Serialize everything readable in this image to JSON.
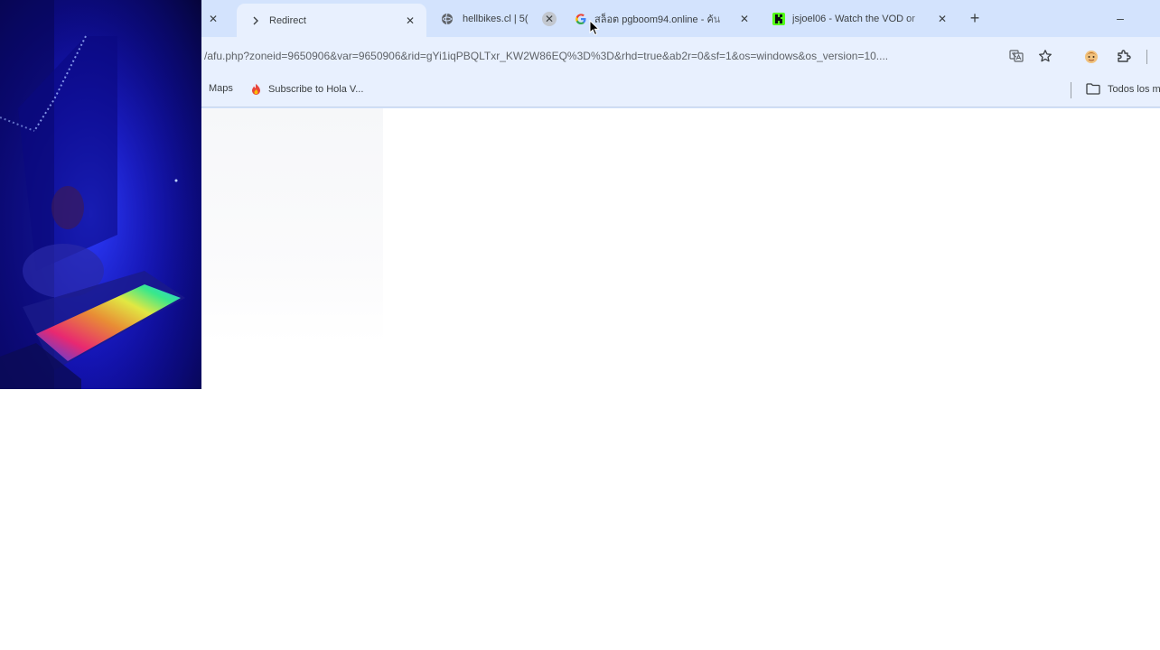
{
  "tabs": [
    {
      "title": "Redirect",
      "favicon": "redirect-chevron-icon",
      "active": true
    },
    {
      "title": "hellbikes.cl | 5(",
      "favicon": "globe-icon",
      "active": false
    },
    {
      "title": "สล็อต pgboom94.online - ค้น",
      "favicon": "google-g-icon",
      "active": false
    },
    {
      "title": "jsjoel06 - Watch the VOD or",
      "favicon": "kick-k-icon",
      "active": false
    }
  ],
  "close_glyph": "✕",
  "new_tab_glyph": "+",
  "minimize_glyph": "–",
  "address_bar": {
    "url": "/afu.php?zoneid=9650906&var=9650906&rid=gYi1iqPBQLTxr_KW2W86EQ%3D%3D&rhd=true&ab2r=0&sf=1&os=windows&os_version=10...."
  },
  "bookmarks": [
    {
      "label": "Maps",
      "icon": ""
    },
    {
      "label": "Subscribe to Hola V...",
      "icon": "flame-icon"
    }
  ],
  "bookmark_folder": {
    "label": "Todos los m",
    "icon": "folder-icon"
  },
  "colors": {
    "tabstrip_bg": "#d3e3fd",
    "toolbar_bg": "#e8f0fe",
    "google_blue": "#4285f4",
    "kick_green": "#53fc18"
  }
}
